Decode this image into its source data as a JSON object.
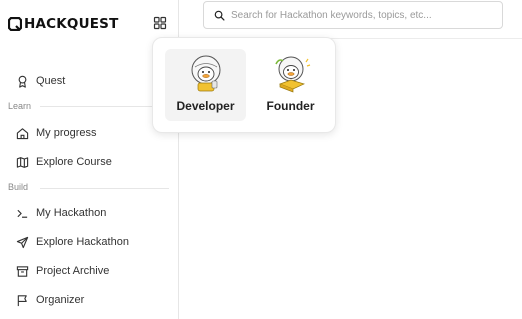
{
  "brand": {
    "name": "HACKQUEST"
  },
  "search": {
    "placeholder": "Search for Hackathon keywords, topics, etc..."
  },
  "sidebar": {
    "quest_label": "Quest",
    "sections": {
      "learn": "Learn",
      "build": "Build"
    },
    "learn_items": [
      {
        "label": "My progress",
        "icon": "home-icon"
      },
      {
        "label": "Explore Course",
        "icon": "map-icon"
      }
    ],
    "build_items": [
      {
        "label": "My Hackathon",
        "icon": "terminal-icon"
      },
      {
        "label": "Explore Hackathon",
        "icon": "send-icon"
      },
      {
        "label": "Project Archive",
        "icon": "archive-icon"
      },
      {
        "label": "Organizer",
        "icon": "flag-icon"
      }
    ]
  },
  "role_switcher": {
    "roles": [
      {
        "label": "Developer",
        "selected": true
      },
      {
        "label": "Founder",
        "selected": false
      }
    ]
  },
  "colors": {
    "accent_yellow": "#f2c230",
    "border": "#e6e6e6",
    "selected_bg": "#f3f3f3"
  }
}
